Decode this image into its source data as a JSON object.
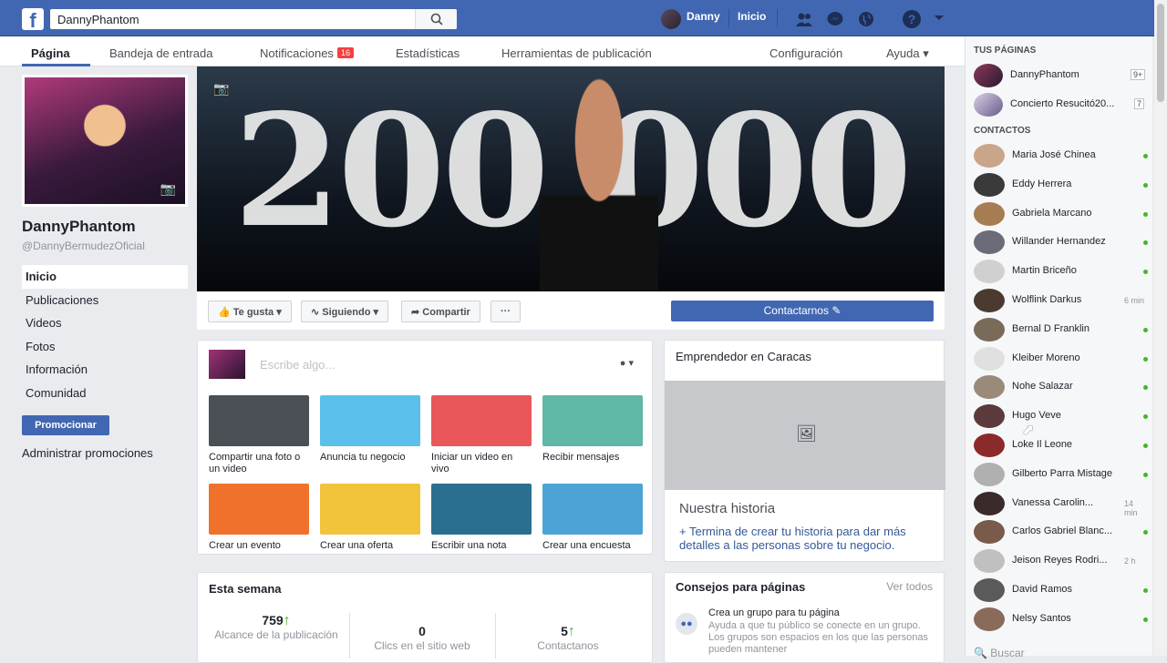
{
  "topbar": {
    "logo": "f",
    "search_value": "DannyPhantom",
    "user_name": "Danny",
    "home_label": "Inicio",
    "icons": [
      "friends-icon",
      "messenger-icon",
      "globe-icon",
      "help-icon",
      "caret-down-icon"
    ],
    "help_glyph": "?"
  },
  "page_tabs": {
    "pagina": "Página",
    "bandeja": "Bandeja de entrada",
    "notificaciones": "Notificaciones",
    "notif_count": "16",
    "estadisticas": "Estadísticas",
    "herramientas": "Herramientas de publicación",
    "configuracion": "Configuración",
    "ayuda": "Ayuda ▾"
  },
  "profile": {
    "name": "DannyPhantom",
    "username": "@DannyBermudezOficial",
    "nav": [
      "Inicio",
      "Publicaciones",
      "Videos",
      "Fotos",
      "Información",
      "Comunidad"
    ],
    "promote_button": "Promocionar",
    "manage_promotions": "Administrar promociones"
  },
  "cover": {
    "text": "200.000"
  },
  "actions": {
    "like": "Te gusta",
    "following": "Siguiendo",
    "share": "Compartir",
    "more": "···",
    "contact": "Contactarnos"
  },
  "composer": {
    "placeholder": "Escribe algo...",
    "tiles": [
      {
        "label": "Compartir una foto o un video",
        "color": "#4b4f56"
      },
      {
        "label": "Anuncia tu negocio",
        "color": "#5bc0eb"
      },
      {
        "label": "Iniciar un video en vivo",
        "color": "#e9575b"
      },
      {
        "label": "Recibir mensajes",
        "color": "#5fb7a6"
      },
      {
        "label": "Crear un evento",
        "color": "#f0712c"
      },
      {
        "label": "Crear una oferta",
        "color": "#f3c43b"
      },
      {
        "label": "Escribir una nota",
        "color": "#2a6f8f"
      },
      {
        "label": "Crear una encuesta",
        "color": "#4da3d6"
      }
    ]
  },
  "business": {
    "title": "Emprendedor en Caracas",
    "story_title": "Nuestra historia",
    "story_link": "+ Termina de crear tu historia para dar más detalles a las personas sobre tu negocio."
  },
  "this_week": {
    "title": "Esta semana",
    "stats": [
      {
        "value": "759",
        "label": "Alcance de la publicación",
        "trend": "up"
      },
      {
        "value": "0",
        "label": "Clics en el sitio web",
        "trend": ""
      },
      {
        "value": "5",
        "label": "Contactanos",
        "trend": "up"
      }
    ]
  },
  "tips": {
    "title": "Consejos para páginas",
    "see_all": "Ver todos",
    "item_title": "Crea un grupo para tu página",
    "item_text": "Ayuda a que tu público se conecte en un grupo. Los grupos son espacios en los que las personas pueden mantener"
  },
  "right_sidebar": {
    "pages_header": "TUS PÁGINAS",
    "pages": [
      {
        "name": "DannyPhantom",
        "badge": "9+"
      },
      {
        "name": "Concierto Resucitó20...",
        "badge": "7"
      }
    ],
    "contacts_header": "CONTACTOS",
    "contacts": [
      {
        "name": "Maria José Chinea",
        "time": "",
        "online": true
      },
      {
        "name": "Eddy Herrera",
        "time": "",
        "online": true
      },
      {
        "name": "Gabriela Marcano",
        "time": "",
        "online": true
      },
      {
        "name": "Willander Hernandez",
        "time": "",
        "online": true
      },
      {
        "name": "Martin Briceño",
        "time": "",
        "online": true
      },
      {
        "name": "Wolflink Darkus",
        "time": "6 min",
        "online": false
      },
      {
        "name": "Bernal D Franklin",
        "time": "",
        "online": true
      },
      {
        "name": "Kleiber Moreno",
        "time": "",
        "online": true
      },
      {
        "name": "Nohe Salazar",
        "time": "",
        "online": true
      },
      {
        "name": "Hugo Veve",
        "time": "",
        "online": true
      },
      {
        "name": "Loke Il Leone",
        "time": "",
        "online": true
      },
      {
        "name": "Gilberto Parra Mistage",
        "time": "",
        "online": true
      },
      {
        "name": "Vanessa Carolin...",
        "time": "14 min",
        "online": false
      },
      {
        "name": "Carlos Gabriel Blanc...",
        "time": "",
        "online": true
      },
      {
        "name": "Jeison Reyes Rodri...",
        "time": "2 h",
        "online": false
      },
      {
        "name": "David Ramos",
        "time": "",
        "online": true
      },
      {
        "name": "Nelsy Santos",
        "time": "",
        "online": true
      }
    ],
    "search_placeholder": "Buscar"
  },
  "colors": {
    "brand": "#4267b2",
    "online": "#42b72a",
    "badge": "#fa3e3e"
  }
}
